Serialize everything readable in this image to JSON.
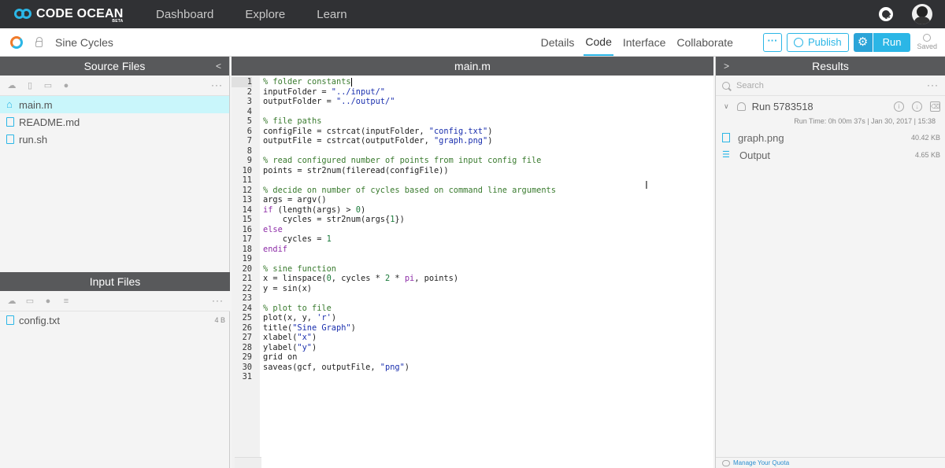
{
  "nav": {
    "logo": "CODE OCEAN",
    "beta": "BETA",
    "links": [
      "Dashboard",
      "Explore",
      "Learn"
    ]
  },
  "project": {
    "name": "Sine Cycles",
    "tabs": [
      "Details",
      "Code",
      "Interface",
      "Collaborate"
    ],
    "active_tab": "Code",
    "more_label": "···",
    "publish_label": "Publish",
    "run_label": "Run",
    "saved_label": "Saved"
  },
  "source_files": {
    "title": "Source Files",
    "files": [
      "main.m",
      "README.md",
      "run.sh"
    ]
  },
  "input_files": {
    "title": "Input Files",
    "files": [
      {
        "name": "config.txt",
        "size": "4 B"
      }
    ]
  },
  "editor": {
    "filename": "main.m",
    "lines": [
      "% folder constants",
      "inputFolder = \"../input/\"",
      "outputFolder = \"../output/\"",
      "",
      "% file paths",
      "configFile = cstrcat(inputFolder, \"config.txt\")",
      "outputFile = cstrcat(outputFolder, \"graph.png\")",
      "",
      "% read configured number of points from input config file",
      "points = str2num(fileread(configFile))",
      "",
      "% decide on number of cycles based on command line arguments",
      "args = argv()",
      "if (length(args) > 0)",
      "    cycles = str2num(args{1})",
      "else",
      "    cycles = 1",
      "endif",
      "",
      "% sine function",
      "x = linspace(0, cycles * 2 * pi, points)",
      "y = sin(x)",
      "",
      "% plot to file",
      "plot(x, y, 'r')",
      "title(\"Sine Graph\")",
      "xlabel(\"x\")",
      "ylabel(\"y\")",
      "grid on",
      "saveas(gcf, outputFile, \"png\")",
      ""
    ]
  },
  "results": {
    "title": "Results",
    "search_placeholder": "Search",
    "run_name": "Run 5783518",
    "run_time": "Run Time: 0h 00m 37s | Jan 30, 2017 | 15:38",
    "files": [
      {
        "name": "graph.png",
        "size": "40.42 KB"
      },
      {
        "name": "Output",
        "size": "4.65 KB"
      }
    ],
    "quota_link": "Manage Your Quota"
  }
}
